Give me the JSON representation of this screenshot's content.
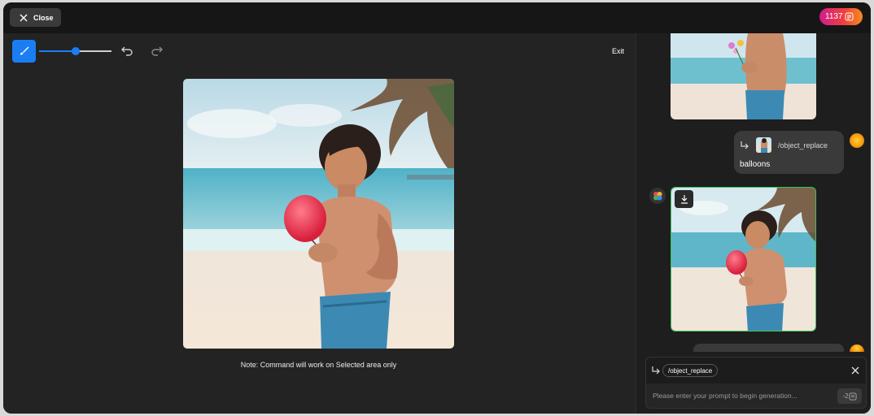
{
  "header": {
    "close_label": "Close",
    "credits": "1137",
    "credits_gradient": [
      "#d21c8e",
      "#f0433a",
      "#f58d1f"
    ]
  },
  "toolbar": {
    "brush_color": "#1a7ef2",
    "brush_size_level": 0.5,
    "exit_label": "Exit"
  },
  "editor": {
    "note": "Note: Command will work on Selected area only"
  },
  "chat": {
    "user_message": {
      "command": "/object_replace",
      "text": "balloons"
    },
    "result_border_color": "#3fc25a"
  },
  "prompt": {
    "command": "/object_replace",
    "placeholder": "Please enter your prompt to begin generation...",
    "cost": "-2"
  }
}
